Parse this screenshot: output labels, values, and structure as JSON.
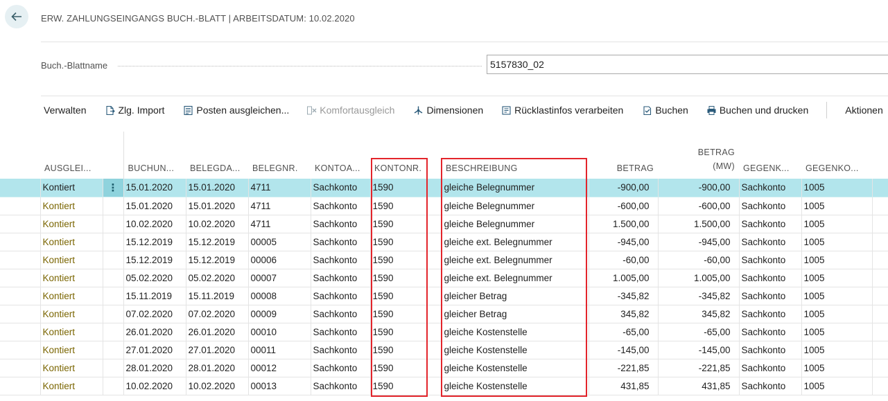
{
  "header": {
    "title": "ERW. ZAHLUNGSEINGANGS BUCH.-BLATT | ARBEITSDATUM: 10.02.2020"
  },
  "batch": {
    "label": "Buch.-Blattname",
    "value": "5157830_02"
  },
  "actions": {
    "verwalten": "Verwalten",
    "zlg_import": "Zlg. Import",
    "posten_ausgleichen": "Posten ausgleichen...",
    "komfortausgleich": "Komfortausgleich",
    "dimensionen": "Dimensionen",
    "ruecklast": "Rücklastinfos verarbeiten",
    "buchen": "Buchen",
    "buchen_drucken": "Buchen und drucken",
    "aktionen": "Aktionen"
  },
  "columns": {
    "ausgleich": "AUSGLEI...",
    "buchungsdatum": "BUCHUN...",
    "belegdatum": "BELEGDA...",
    "belegnr": "BELEGNR.",
    "kontoart": "KONTOA...",
    "kontonr": "KONTONR.",
    "beschreibung": "BESCHREIBUNG",
    "betrag": "BETRAG",
    "betrag_mw_1": "BETRAG",
    "betrag_mw_2": "(MW)",
    "gegenkontoart": "GEGENK...",
    "gegenkontonr": "GEGENKO..."
  },
  "rows": [
    {
      "status": "Kontiert",
      "buchungsdatum": "15.01.2020",
      "belegdatum": "15.01.2020",
      "belegnr": "4711",
      "kontoart": "Sachkonto",
      "kontonr": "1590",
      "beschreibung": "gleiche Belegnummer",
      "betrag": "-900,00",
      "betrag_mw": "-900,00",
      "gegenkontoart": "Sachkonto",
      "gegenkontonr": "1005"
    },
    {
      "status": "Kontiert",
      "buchungsdatum": "15.01.2020",
      "belegdatum": "15.01.2020",
      "belegnr": "4711",
      "kontoart": "Sachkonto",
      "kontonr": "1590",
      "beschreibung": "gleiche Belegnummer",
      "betrag": "-600,00",
      "betrag_mw": "-600,00",
      "gegenkontoart": "Sachkonto",
      "gegenkontonr": "1005"
    },
    {
      "status": "Kontiert",
      "buchungsdatum": "10.02.2020",
      "belegdatum": "10.02.2020",
      "belegnr": "4711",
      "kontoart": "Sachkonto",
      "kontonr": "1590",
      "beschreibung": "gleiche Belegnummer",
      "betrag": "1.500,00",
      "betrag_mw": "1.500,00",
      "gegenkontoart": "Sachkonto",
      "gegenkontonr": "1005"
    },
    {
      "status": "Kontiert",
      "buchungsdatum": "15.12.2019",
      "belegdatum": "15.12.2019",
      "belegnr": "00005",
      "kontoart": "Sachkonto",
      "kontonr": "1590",
      "beschreibung": "gleiche ext. Belegnummer",
      "betrag": "-945,00",
      "betrag_mw": "-945,00",
      "gegenkontoart": "Sachkonto",
      "gegenkontonr": "1005"
    },
    {
      "status": "Kontiert",
      "buchungsdatum": "15.12.2019",
      "belegdatum": "15.12.2019",
      "belegnr": "00006",
      "kontoart": "Sachkonto",
      "kontonr": "1590",
      "beschreibung": "gleiche ext. Belegnummer",
      "betrag": "-60,00",
      "betrag_mw": "-60,00",
      "gegenkontoart": "Sachkonto",
      "gegenkontonr": "1005"
    },
    {
      "status": "Kontiert",
      "buchungsdatum": "05.02.2020",
      "belegdatum": "05.02.2020",
      "belegnr": "00007",
      "kontoart": "Sachkonto",
      "kontonr": "1590",
      "beschreibung": "gleiche ext. Belegnummer",
      "betrag": "1.005,00",
      "betrag_mw": "1.005,00",
      "gegenkontoart": "Sachkonto",
      "gegenkontonr": "1005"
    },
    {
      "status": "Kontiert",
      "buchungsdatum": "15.11.2019",
      "belegdatum": "15.11.2019",
      "belegnr": "00008",
      "kontoart": "Sachkonto",
      "kontonr": "1590",
      "beschreibung": "gleicher Betrag",
      "betrag": "-345,82",
      "betrag_mw": "-345,82",
      "gegenkontoart": "Sachkonto",
      "gegenkontonr": "1005"
    },
    {
      "status": "Kontiert",
      "buchungsdatum": "07.02.2020",
      "belegdatum": "07.02.2020",
      "belegnr": "00009",
      "kontoart": "Sachkonto",
      "kontonr": "1590",
      "beschreibung": "gleicher Betrag",
      "betrag": "345,82",
      "betrag_mw": "345,82",
      "gegenkontoart": "Sachkonto",
      "gegenkontonr": "1005"
    },
    {
      "status": "Kontiert",
      "buchungsdatum": "26.01.2020",
      "belegdatum": "26.01.2020",
      "belegnr": "00010",
      "kontoart": "Sachkonto",
      "kontonr": "1590",
      "beschreibung": "gleiche Kostenstelle",
      "betrag": "-65,00",
      "betrag_mw": "-65,00",
      "gegenkontoart": "Sachkonto",
      "gegenkontonr": "1005"
    },
    {
      "status": "Kontiert",
      "buchungsdatum": "27.01.2020",
      "belegdatum": "27.01.2020",
      "belegnr": "00011",
      "kontoart": "Sachkonto",
      "kontonr": "1590",
      "beschreibung": "gleiche Kostenstelle",
      "betrag": "-145,00",
      "betrag_mw": "-145,00",
      "gegenkontoart": "Sachkonto",
      "gegenkontonr": "1005"
    },
    {
      "status": "Kontiert",
      "buchungsdatum": "28.01.2020",
      "belegdatum": "28.01.2020",
      "belegnr": "00012",
      "kontoart": "Sachkonto",
      "kontonr": "1590",
      "beschreibung": "gleiche Kostenstelle",
      "betrag": "-221,85",
      "betrag_mw": "-221,85",
      "gegenkontoart": "Sachkonto",
      "gegenkontonr": "1005"
    },
    {
      "status": "Kontiert",
      "buchungsdatum": "10.02.2020",
      "belegdatum": "10.02.2020",
      "belegnr": "00013",
      "kontoart": "Sachkonto",
      "kontonr": "1590",
      "beschreibung": "gleiche Kostenstelle",
      "betrag": "431,85",
      "betrag_mw": "431,85",
      "gegenkontoart": "Sachkonto",
      "gegenkontonr": "1005"
    }
  ],
  "selected_row": 0,
  "icons": {
    "back": "arrow-left-icon",
    "zlg_import": "document-import-icon",
    "posten_ausgleichen": "ledger-icon",
    "komfortausgleich": "match-icon",
    "dimensionen": "dimensions-icon",
    "ruecklast": "return-icon",
    "buchen": "post-icon",
    "buchen_drucken": "printer-icon",
    "row_menu": "more-vertical-icon"
  },
  "colors": {
    "selected_row": "#b2e5ec",
    "status_text": "#7a6500",
    "highlight": "#e3242b"
  }
}
